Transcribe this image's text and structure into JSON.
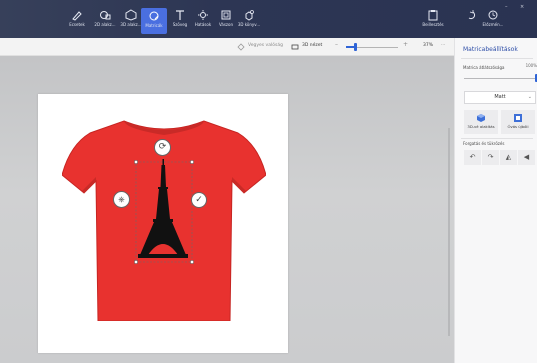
{
  "toolbar": {
    "items": [
      {
        "label": "Ecsetek",
        "icon": "brush-icon"
      },
      {
        "label": "2D alakz...",
        "icon": "shapes-2d-icon"
      },
      {
        "label": "3D alakz...",
        "icon": "shapes-3d-icon"
      },
      {
        "label": "Matricák",
        "icon": "stickers-icon"
      },
      {
        "label": "Szöveg",
        "icon": "text-icon"
      },
      {
        "label": "Hatások",
        "icon": "effects-icon"
      },
      {
        "label": "Vászon",
        "icon": "canvas-icon"
      },
      {
        "label": "3D könyv...",
        "icon": "library-3d-icon"
      }
    ],
    "right_items": [
      {
        "label": "Beillesztés",
        "icon": "paste-icon"
      },
      {
        "label": "Előzmén...",
        "icon": "history-icon"
      }
    ],
    "window_controls": [
      "–",
      "×"
    ]
  },
  "viewbar": {
    "mixed_reality": "Vegyes valóság",
    "view_3d": "3D nézet",
    "zoom_minus": "–",
    "zoom_plus": "+",
    "zoom_value": "37%",
    "more": "···"
  },
  "panel": {
    "title": "Matricabeállítások",
    "opacity_label": "Matrica átlátszósága",
    "opacity_value": "100%",
    "opacity_fraction": 1.0,
    "finish_select": "Matt",
    "make_3d_label": "3D-vé alakítás",
    "make_3d_icon": "cube-icon",
    "stamp_label": "Óvás újbóli",
    "stamp_icon": "stamp-icon",
    "rotate_label": "Forgatás és tükrözés",
    "rotate_buttons": [
      {
        "icon": "rotate-left-icon",
        "glyph": "↶"
      },
      {
        "icon": "rotate-right-icon",
        "glyph": "↷"
      },
      {
        "icon": "flip-vertical-icon",
        "glyph": "◭"
      },
      {
        "icon": "flip-horizontal-icon",
        "glyph": "◀"
      }
    ]
  },
  "canvas": {
    "shirt_color": "#e8322f",
    "sticker": "eiffel-tower"
  },
  "colors": {
    "toolbar_bg": "#2d3654",
    "accent": "#2f64d6",
    "panel_bg": "#f7f7f8"
  }
}
